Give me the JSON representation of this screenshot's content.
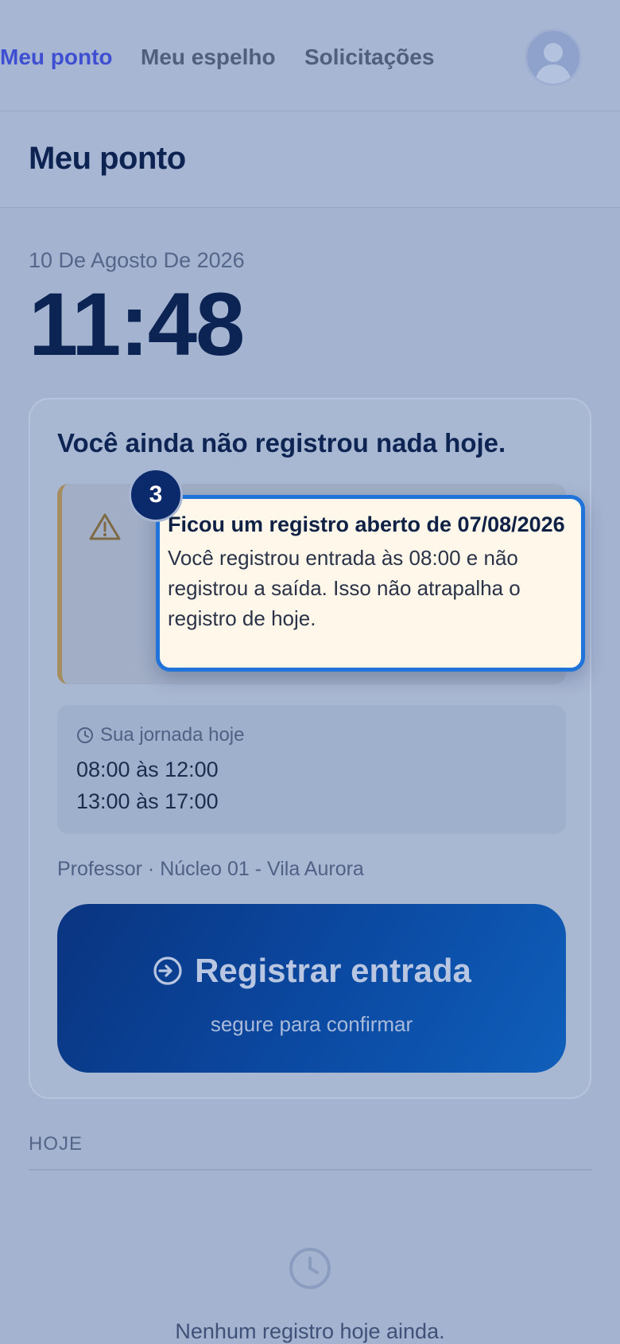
{
  "nav": {
    "tabs": [
      {
        "label": "Meu ponto",
        "active": true
      },
      {
        "label": "Meu espelho",
        "active": false
      },
      {
        "label": "Solicitações",
        "active": false
      }
    ]
  },
  "header": {
    "title": "Meu ponto"
  },
  "clock": {
    "date": "10 De Agosto De 2026",
    "time": "11:48"
  },
  "card": {
    "heading": "Você ainda não registrou nada hoje.",
    "alert": {
      "step": "3",
      "title": "Ficou um registro aberto de 07/08/2026",
      "body": "Você registrou entrada às 08:00 e não registrou a saída. Isso não atrapalha o registro de hoje."
    },
    "schedule": {
      "label": "Sua jornada hoje",
      "periods": [
        "08:00 às 12:00",
        "13:00 às 17:00"
      ]
    },
    "role": "Professor · Núcleo 01 - Vila Aurora",
    "register_button": {
      "label": "Registrar entrada",
      "hint": "segure para confirmar"
    }
  },
  "today": {
    "label": "HOJE",
    "empty_message": "Nenhum registro hoje ainda."
  },
  "colors": {
    "accent": "#3f4fd1",
    "primary": "#0b4aa3",
    "highlight": "#1f73d9"
  }
}
